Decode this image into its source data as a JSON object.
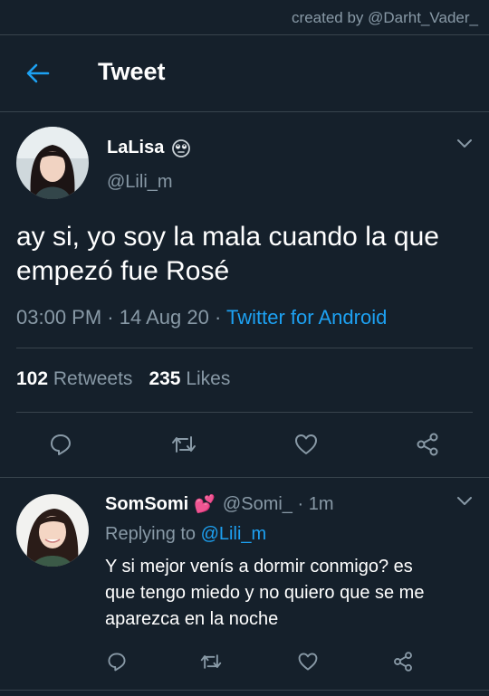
{
  "watermark": "created by @Darht_Vader_",
  "header": {
    "title": "Tweet",
    "back_icon": "arrow-left-icon"
  },
  "colors": {
    "background": "#15202b",
    "accent": "#1da1f2",
    "muted": "#8899a6",
    "divider": "#38444d"
  },
  "tweet": {
    "name": "LaLisa",
    "name_emoji": "🙄",
    "handle": "@Lili_m",
    "text_line1": "ay si, yo soy la mala cuando la que",
    "text_line2": "empezó fue Rosé",
    "time": "03:00 PM",
    "sep1": "·",
    "date": "14 Aug 20",
    "sep2": "·",
    "source": "Twitter for Android",
    "retweets_count": "102",
    "retweets_label": "Retweets",
    "likes_count": "235",
    "likes_label": "Likes",
    "actions": [
      "reply-icon",
      "retweet-icon",
      "like-icon",
      "share-icon"
    ]
  },
  "reply": {
    "name": "SomSomi",
    "name_emoji": "💕",
    "handle": "@Somi_",
    "sep": "·",
    "age": "1m",
    "replying_prefix": "Replying to",
    "replying_to": "@Lili_m",
    "text_line1": "Y si mejor venís a dormir conmigo? es",
    "text_line2": "que tengo miedo y no quiero que se me",
    "text_line3": "aparezca en la noche",
    "actions": [
      "reply-icon",
      "retweet-icon",
      "like-icon",
      "share-icon"
    ]
  }
}
